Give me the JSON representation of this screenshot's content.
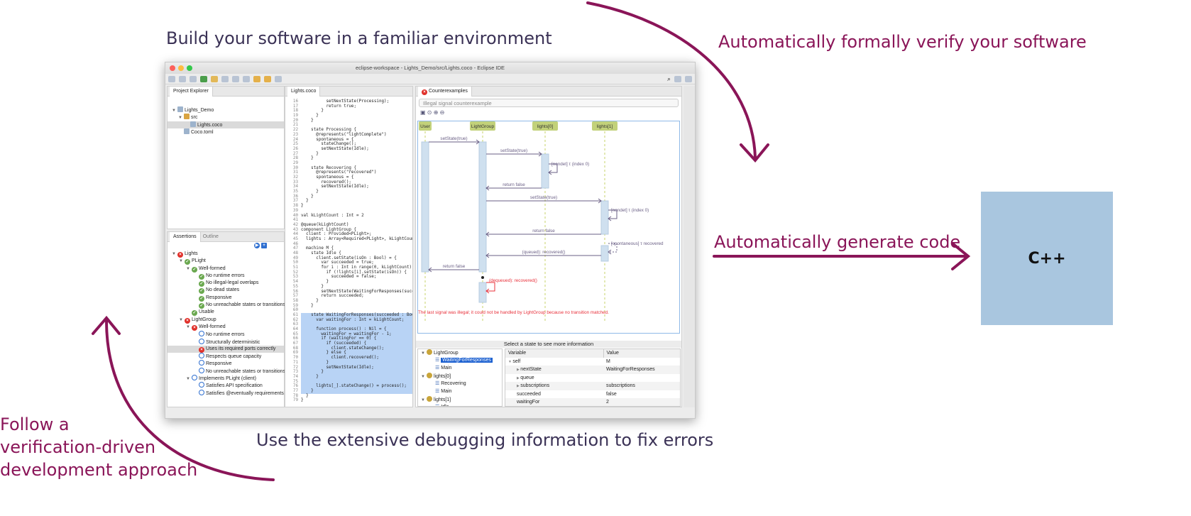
{
  "captions": {
    "top": "Build your software in a familiar environment",
    "verify": "Automatically formally verify your software",
    "generate": "Automatically generate code",
    "debug": "Use the extensive debugging information to fix errors",
    "follow": [
      "Follow a",
      "verification-driven",
      "development approach"
    ],
    "output_box": "C++"
  },
  "colors": {
    "accent": "#8a1558",
    "caption": "#3b3256",
    "cpp_box": "#a9c6df",
    "highlight": "#b8d3f5",
    "error": "#e0302a",
    "ok": "#6aa84f"
  },
  "window": {
    "title": "eclipse-workspace - Lights_Demo/src/Lights.coco - Eclipse IDE"
  },
  "project_explorer": {
    "tab": "Project Explorer",
    "items": [
      {
        "label": "Lights_Demo",
        "depth": 0,
        "icon": "project-icon"
      },
      {
        "label": "src",
        "depth": 1,
        "icon": "folder-icon"
      },
      {
        "label": "Lights.coco",
        "depth": 2,
        "icon": "coco-file-icon",
        "selected": true
      },
      {
        "label": "Coco.toml",
        "depth": 1,
        "icon": "file-icon"
      }
    ]
  },
  "assertions": {
    "tab": "Assertions",
    "tab2": "Outline",
    "items": [
      {
        "label": "Lights",
        "depth": 0,
        "status": "err",
        "open": true
      },
      {
        "label": "PLight",
        "depth": 1,
        "status": "ok",
        "open": true
      },
      {
        "label": "Well-formed",
        "depth": 2,
        "status": "ok",
        "open": true
      },
      {
        "label": "No runtime errors",
        "depth": 3,
        "status": "ok"
      },
      {
        "label": "No illegal-legal overlaps",
        "depth": 3,
        "status": "ok"
      },
      {
        "label": "No dead states",
        "depth": 3,
        "status": "ok"
      },
      {
        "label": "Responsive",
        "depth": 3,
        "status": "ok"
      },
      {
        "label": "No unreachable states or transitions",
        "depth": 3,
        "status": "ok"
      },
      {
        "label": "Usable",
        "depth": 2,
        "status": "ok"
      },
      {
        "label": "LightGroup",
        "depth": 1,
        "status": "err",
        "open": true
      },
      {
        "label": "Well-formed",
        "depth": 2,
        "status": "err",
        "open": true
      },
      {
        "label": "No runtime errors",
        "depth": 3,
        "status": "pend"
      },
      {
        "label": "Structurally deterministic",
        "depth": 3,
        "status": "pend"
      },
      {
        "label": "Uses its required ports correctly",
        "depth": 3,
        "status": "err",
        "selected": true
      },
      {
        "label": "Respects queue capacity",
        "depth": 3,
        "status": "pend"
      },
      {
        "label": "Responsive",
        "depth": 3,
        "status": "pend"
      },
      {
        "label": "No unreachable states or transitions",
        "depth": 3,
        "status": "pend"
      },
      {
        "label": "Implements PLight (client)",
        "depth": 2,
        "status": "pend",
        "open": true
      },
      {
        "label": "Satisfies API specification",
        "depth": 3,
        "status": "pend"
      },
      {
        "label": "Satisfies @eventually requirements",
        "depth": 3,
        "status": "pend"
      }
    ]
  },
  "editor": {
    "tab": "Lights.coco",
    "first_line": 16,
    "highlight": [
      61,
      77
    ],
    "lines": [
      "          setNextState(Processing);",
      "          return true;",
      "        }",
      "      }",
      "    }",
      "",
      "    state Processing {",
      "      @represents(\"lightComplete\")",
      "      spontaneous = {",
      "        stateChange();",
      "        setNextState(Idle);",
      "      }",
      "    }",
      "",
      "    state Recovering {",
      "      @represents(\"recovered\")",
      "      spontaneous = {",
      "        recovered();",
      "        setNextState(Idle);",
      "      }",
      "    }",
      "  }",
      "}",
      "",
      "val kLightCount : Int = 2",
      "",
      "@queue(kLightCount)",
      "component LightGroup {",
      "  client : Provided<PLight>;",
      "  lights : Array<Required<PLight>, kLightCount>;",
      "",
      "  machine M {",
      "    state Idle {",
      "      client.setState(isOn : Bool) = {",
      "        var succeeded = true;",
      "        for i : Int in range(0, kLightCount) {",
      "          if (!lights[i].setState(isOn)) {",
      "            succeeded = false;",
      "          }",
      "        }",
      "        setNextState(WaitingForResponses(succeeded));",
      "        return succeeded;",
      "      }",
      "    }",
      "",
      "    state WaitingForResponses(succeeded : Bool) {",
      "      var waitingFor : Int = kLightCount;",
      "",
      "      function process() : Nil = {",
      "        waitingFor = waitingFor - 1;",
      "        if (waitingFor == 0) {",
      "          if (succeeded) {",
      "            client.stateChange();",
      "          } else {",
      "            client.recovered();",
      "          }",
      "          setNextState(Idle);",
      "        }",
      "      }",
      "",
      "      lights[_].stateChange() = process();",
      "    }",
      "  }",
      "}"
    ]
  },
  "counterexamples": {
    "tab": "Counterexamples",
    "selector": "Illegal signal counterexample",
    "lifelines": [
      "User",
      "LightGroup",
      "lights[0]",
      "lights[1]"
    ],
    "messages": [
      {
        "label": "setState(true)",
        "from": 0,
        "to": 1
      },
      {
        "label": "setState(true)",
        "from": 1,
        "to": 2
      },
      {
        "label": "[nondet] τ (index 0)",
        "from": 2,
        "to": 2
      },
      {
        "label": "return false",
        "from": 2,
        "to": 1
      },
      {
        "label": "setState(true)",
        "from": 1,
        "to": 3
      },
      {
        "label": "[nondet] τ (index 0)",
        "from": 3,
        "to": 3
      },
      {
        "label": "return false",
        "from": 3,
        "to": 1
      },
      {
        "label": "[spontaneous] τ recovered",
        "from": 3,
        "to": 3
      },
      {
        "label": "(queued): recovered()",
        "from": 3,
        "to": 1
      },
      {
        "label": "return false",
        "from": 1,
        "to": 0
      },
      {
        "label": "(dequeued): recovered()",
        "from": 1,
        "to": 1,
        "illegal": true
      }
    ],
    "error": "The last signal was illegal; it could not be handled by LightGroup because no transition matched.",
    "info_header": "Select a state to see more information",
    "states": [
      {
        "label": "LightGroup",
        "group": true
      },
      {
        "label": "WaitingForResponses",
        "selected": true
      },
      {
        "label": "Main"
      },
      {
        "label": "lights[0]",
        "group": true
      },
      {
        "label": "Recovering"
      },
      {
        "label": "Main"
      },
      {
        "label": "lights[1]",
        "group": true
      },
      {
        "label": "Idle"
      }
    ],
    "columns": [
      "Variable",
      "Value"
    ],
    "variables": [
      {
        "name": "self",
        "value": "M",
        "depth": 0,
        "exp": "open"
      },
      {
        "name": "nextState",
        "value": "WaitingForResponses",
        "depth": 1,
        "exp": "closed"
      },
      {
        "name": "queue",
        "value": "",
        "depth": 1,
        "exp": "closed"
      },
      {
        "name": "subscriptions",
        "value": "subscriptions",
        "depth": 1,
        "exp": "closed"
      },
      {
        "name": "succeeded",
        "value": "false",
        "depth": 1
      },
      {
        "name": "waitingFor",
        "value": "2",
        "depth": 1
      }
    ]
  }
}
